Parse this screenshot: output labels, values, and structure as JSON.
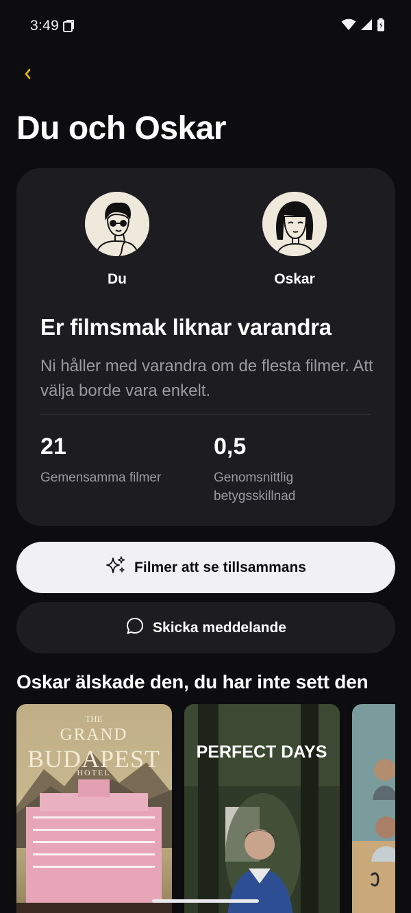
{
  "status_bar": {
    "time": "3:49",
    "icons": [
      "notification-icon",
      "wifi-icon",
      "cellular-icon",
      "battery-icon"
    ]
  },
  "header": {
    "back_icon": "chevron-left-icon",
    "title": "Du och Oskar"
  },
  "match_card": {
    "you": {
      "name": "Du",
      "avatar": "avatar-illustration-glasses"
    },
    "other": {
      "name": "Oskar",
      "avatar": "avatar-illustration-bob-hair"
    },
    "heading": "Er filmsmak liknar varandra",
    "description": "Ni håller med varandra om de flesta filmer. Att välja borde vara enkelt.",
    "stats": [
      {
        "value": "21",
        "label": "Gemensamma filmer"
      },
      {
        "value": "0,5",
        "label": "Genomsnittlig betygsskillnad"
      }
    ]
  },
  "actions": {
    "primary": {
      "label": "Filmer att se tillsammans",
      "icon": "sparkles-icon"
    },
    "secondary": {
      "label": "Skicka meddelande",
      "icon": "chat-bubble-icon"
    }
  },
  "section": {
    "title": "Oskar älskade den, du har inte sett den",
    "posters": [
      {
        "title_lines": [
          "THE",
          "GRAND",
          "BUDAPEST",
          "HOTEL"
        ]
      },
      {
        "title_lines": [
          "PERFECT DAYS"
        ]
      },
      {
        "title_lines": []
      }
    ]
  },
  "colors": {
    "background": "#0d0d10",
    "card": "#1c1c21",
    "accent": "#f5b800",
    "muted_text": "#9a9aa2",
    "primary_button": "#f1f0f5"
  }
}
